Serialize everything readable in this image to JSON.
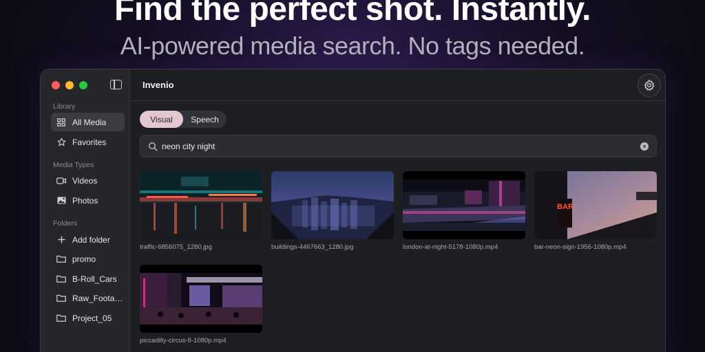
{
  "hero": {
    "title": "Find the perfect shot. Instantly.",
    "subtitle": "AI-powered media search. No tags needed."
  },
  "app": {
    "title": "Invenio"
  },
  "sidebar": {
    "library_label": "Library",
    "library_items": [
      {
        "label": "All Media",
        "icon": "grid-icon",
        "active": true
      },
      {
        "label": "Favorites",
        "icon": "star-icon",
        "active": false
      }
    ],
    "media_types_label": "Media Types",
    "media_types_items": [
      {
        "label": "Videos",
        "icon": "video-icon"
      },
      {
        "label": "Photos",
        "icon": "photo-icon"
      }
    ],
    "folders_label": "Folders",
    "folder_items": [
      {
        "label": "Add folder",
        "icon": "plus-icon"
      },
      {
        "label": "promo",
        "icon": "folder-icon"
      },
      {
        "label": "B-Roll_Cars",
        "icon": "folder-icon"
      },
      {
        "label": "Raw_Foota…",
        "icon": "folder-icon"
      },
      {
        "label": "Project_05",
        "icon": "folder-icon"
      }
    ]
  },
  "search_mode": {
    "options": [
      "Visual",
      "Speech"
    ],
    "selected": "Visual"
  },
  "search": {
    "value": "neon city night"
  },
  "results": [
    {
      "filename": "traffic-6856075_1280.jpg"
    },
    {
      "filename": "buildings-4467663_1280.jpg"
    },
    {
      "filename": "london-at-night-5178-1080p.mp4"
    },
    {
      "filename": "bar-neon-sign-1956-1080p.mp4"
    },
    {
      "filename": "piccadilly-circus-8-1080p.mp4"
    }
  ],
  "thumbnails": {
    "bar_sign_text": "BAR"
  },
  "colors": {
    "accent_selected": "#e3c9cf",
    "traffic_red": "#ff5f57",
    "traffic_yellow": "#febc2e",
    "traffic_green": "#28c840"
  }
}
